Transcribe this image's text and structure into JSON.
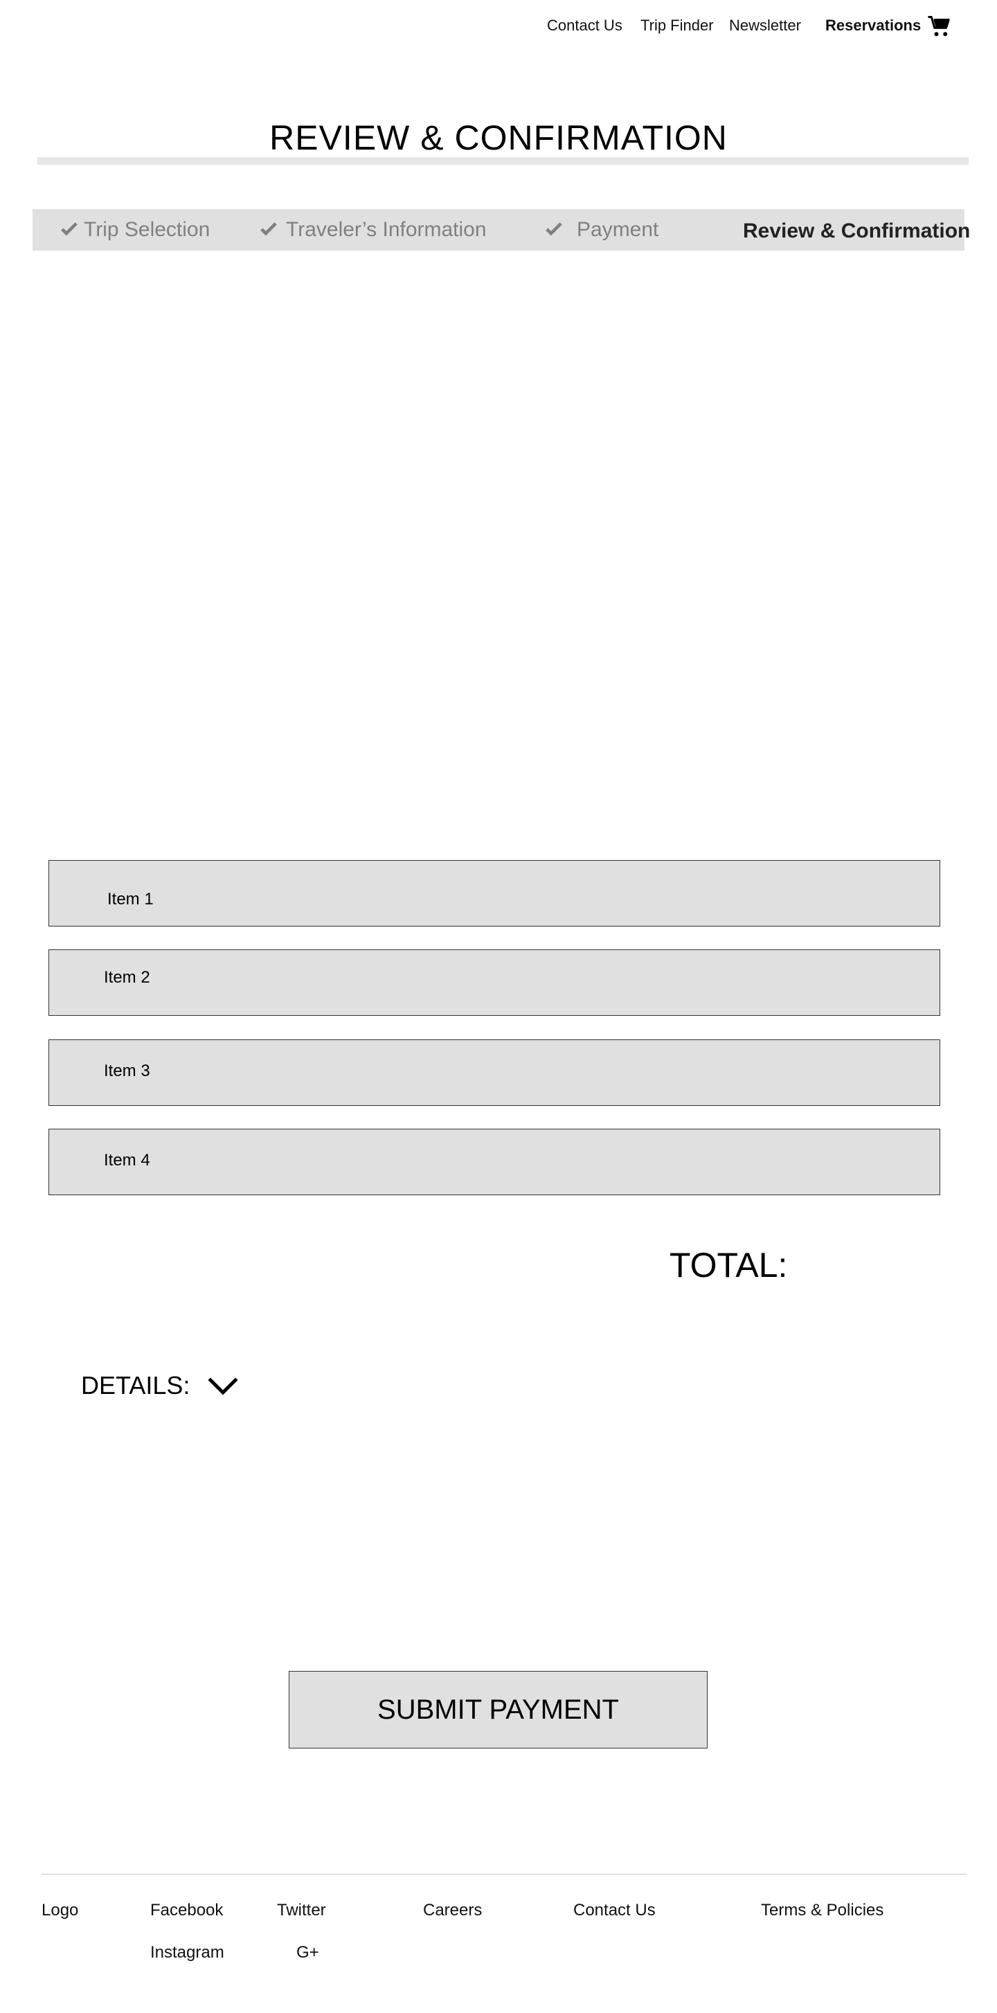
{
  "nav": {
    "contact_us": "Contact Us",
    "trip_finder": "Trip Finder",
    "newsletter": "Newsletter",
    "reservations": "Reservations",
    "cart_icon": "shopping-cart-icon"
  },
  "page": {
    "title": "REVIEW &  CONFIRMATION"
  },
  "stepper": {
    "steps": [
      {
        "label": "Trip Selection",
        "status": "complete",
        "icon": "check-icon"
      },
      {
        "label": "Traveler’s Information",
        "status": "complete",
        "icon": "check-icon"
      },
      {
        "label": "Payment",
        "status": "complete",
        "icon": "check-icon"
      },
      {
        "label": "Review & Confirmation",
        "status": "active"
      }
    ]
  },
  "items": [
    {
      "label": "Item 1"
    },
    {
      "label": "Item 2"
    },
    {
      "label": "Item 3"
    },
    {
      "label": "Item 4"
    }
  ],
  "summary": {
    "total_label": "TOTAL:",
    "details_label": "DETAILS:",
    "details_toggle_icon": "chevron-down-icon"
  },
  "actions": {
    "submit_label": "SUBMIT PAYMENT"
  },
  "footer": {
    "logo": "Logo",
    "facebook": "Facebook",
    "instagram": "Instagram",
    "twitter": "Twitter",
    "gplus": "G+",
    "careers": "Careers",
    "contact_us": "Contact Us",
    "terms": "Terms & Policies"
  },
  "colors": {
    "panel_gray": "#e0e0e0",
    "muted_text": "#808080",
    "rule_gray": "#e6e6e6"
  }
}
